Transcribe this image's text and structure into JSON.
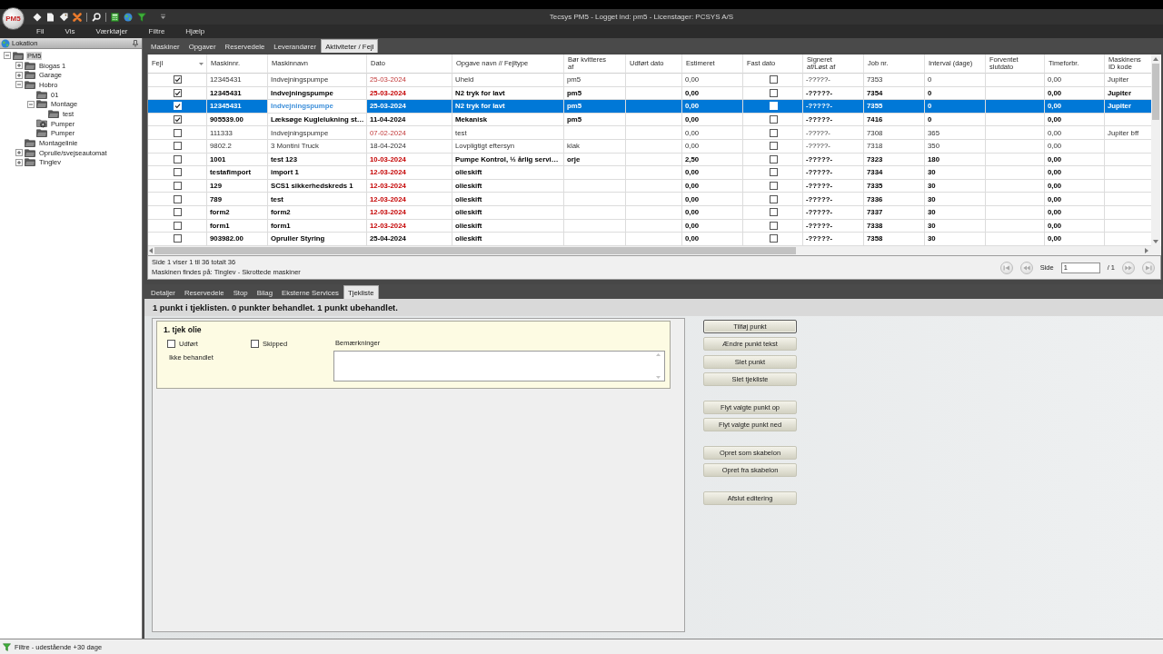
{
  "window": {
    "logo": "PM5",
    "title": "Tecsys PM5 - Logget ind: pm5 - Licenstager: PCSYS A/S"
  },
  "menu": [
    "Fil",
    "Vis",
    "Værktøjer",
    "Filtre",
    "Hjælp"
  ],
  "sidebar": {
    "title": "Lokation",
    "tree": [
      {
        "label": "PM5",
        "kind": "folder",
        "expanded": true,
        "selected": true,
        "children": [
          {
            "label": "Biogas 1",
            "kind": "folder",
            "expanded": false,
            "selected": false
          },
          {
            "label": "Garage",
            "kind": "folder",
            "expanded": false,
            "selected": false
          },
          {
            "label": "Hobro",
            "kind": "folder",
            "expanded": true,
            "selected": false,
            "children": [
              {
                "label": "01",
                "kind": "folder",
                "selected": false
              },
              {
                "label": "Montage",
                "kind": "folder",
                "expanded": true,
                "selected": false,
                "children": [
                  {
                    "label": "test",
                    "kind": "folder",
                    "selected": false
                  }
                ]
              },
              {
                "label": "Pumper",
                "kind": "machine-folder",
                "selected": false
              },
              {
                "label": "Pumper",
                "kind": "folder",
                "selected": false
              }
            ]
          },
          {
            "label": "Montagelinie",
            "kind": "folder",
            "selected": false
          },
          {
            "label": "Oprulle/svejseautomat",
            "kind": "folder",
            "expanded": false,
            "selected": false
          },
          {
            "label": "Tinglev",
            "kind": "folder",
            "expanded": false,
            "selected": false
          }
        ]
      }
    ]
  },
  "tabs": [
    {
      "label": "Maskiner",
      "selected": false
    },
    {
      "label": "Opgaver",
      "selected": false
    },
    {
      "label": "Reservedele",
      "selected": false
    },
    {
      "label": "Leverandører",
      "selected": false
    },
    {
      "label": "Aktiviteter / Fejl",
      "selected": true
    }
  ],
  "table": {
    "columns": [
      {
        "label": "Fejl",
        "kind": "check",
        "sorted": true
      },
      {
        "label": "Maskinnr.",
        "kind": "text",
        "sorted": false
      },
      {
        "label": "Maskinnavn",
        "kind": "text",
        "sorted": false
      },
      {
        "label": "Dato",
        "kind": "date",
        "sorted": false
      },
      {
        "label": "Opgave navn // Fejltype",
        "kind": "text",
        "sorted": false
      },
      {
        "label": "Bør kvitteres af",
        "kind": "text",
        "sorted": false
      },
      {
        "label": "Udført dato",
        "kind": "text",
        "sorted": false
      },
      {
        "label": "Estimeret",
        "kind": "text",
        "sorted": false
      },
      {
        "label": "Fast dato",
        "kind": "check",
        "sorted": false
      },
      {
        "label": "Signeret af/Løst af",
        "kind": "text",
        "sorted": false
      },
      {
        "label": "Job nr.",
        "kind": "text",
        "sorted": false
      },
      {
        "label": "Interval (dage)",
        "kind": "text",
        "sorted": false
      },
      {
        "label": "Forventet slutdato",
        "kind": "text",
        "sorted": false
      },
      {
        "label": "Timeforbr.",
        "kind": "text",
        "sorted": false
      },
      {
        "label": "Maskinens ID kode",
        "kind": "text",
        "sorted": false
      }
    ],
    "rows": [
      {
        "selected": false,
        "bold": false,
        "overdue": true,
        "cells": [
          {
            "checked": true
          },
          "12345431",
          "Indvejningspumpe",
          "25-03-2024",
          "Uheld",
          "pm5",
          null,
          "0,00",
          {
            "checked": false
          },
          "-?????-",
          "7353",
          "0",
          null,
          "0,00",
          "Jupiter"
        ]
      },
      {
        "selected": false,
        "bold": true,
        "overdue": true,
        "cells": [
          {
            "checked": true
          },
          "12345431",
          "Indvejningspumpe",
          "25-03-2024",
          "N2 tryk for lavt",
          "pm5",
          null,
          "0,00",
          {
            "checked": false
          },
          "-?????-",
          "7354",
          "0",
          null,
          "0,00",
          "Jupiter"
        ]
      },
      {
        "selected": true,
        "bold": true,
        "overdue": true,
        "cells": [
          {
            "checked": true
          },
          "12345431",
          {
            "text": "Indvejningspumpe",
            "focused": true
          },
          "25-03-2024",
          "N2 tryk for lavt",
          "pm5",
          null,
          "0,00",
          {
            "checked": false
          },
          "-?????-",
          "7355",
          "0",
          null,
          "0,00",
          "Jupiter"
        ]
      },
      {
        "selected": false,
        "bold": true,
        "overdue": false,
        "cells": [
          {
            "checked": true
          },
          "905539.00",
          "Læksøge Kuglelukning st…",
          "11-04-2024",
          "Mekanisk",
          "pm5",
          null,
          "0,00",
          {
            "checked": false
          },
          "-?????-",
          "7416",
          "0",
          null,
          "0,00",
          null
        ]
      },
      {
        "selected": false,
        "bold": false,
        "overdue": true,
        "cells": [
          {
            "checked": false
          },
          "111333",
          "Indvejningspumpe",
          "07-02-2024",
          "test",
          null,
          null,
          "0,00",
          {
            "checked": false
          },
          "-?????-",
          "7308",
          "365",
          null,
          "0,00",
          "Jupiter bff"
        ]
      },
      {
        "selected": false,
        "bold": false,
        "overdue": false,
        "cells": [
          {
            "checked": false
          },
          "9802.2",
          "3 Montini Truck",
          "18-04-2024",
          "Lovpligtigt eftersyn",
          "klak",
          null,
          "0,00",
          {
            "checked": false
          },
          "-?????-",
          "7318",
          "350",
          null,
          "0,00",
          null
        ]
      },
      {
        "selected": false,
        "bold": true,
        "overdue": true,
        "cells": [
          {
            "checked": false
          },
          "1001",
          "test 123",
          "10-03-2024",
          "Pumpe Kontrol, ½ årlig servi…",
          "orje",
          null,
          "2,50",
          {
            "checked": false
          },
          "-?????-",
          "7323",
          "180",
          null,
          "0,00",
          null
        ]
      },
      {
        "selected": false,
        "bold": true,
        "overdue": true,
        "cells": [
          {
            "checked": false
          },
          "testafimport",
          "import 1",
          "12-03-2024",
          "olieskift",
          null,
          null,
          "0,00",
          {
            "checked": false
          },
          "-?????-",
          "7334",
          "30",
          null,
          "0,00",
          null
        ]
      },
      {
        "selected": false,
        "bold": true,
        "overdue": true,
        "cells": [
          {
            "checked": false
          },
          "129",
          "SCS1 sikkerhedskreds 1",
          "12-03-2024",
          "olieskift",
          null,
          null,
          "0,00",
          {
            "checked": false
          },
          "-?????-",
          "7335",
          "30",
          null,
          "0,00",
          null
        ]
      },
      {
        "selected": false,
        "bold": true,
        "overdue": true,
        "cells": [
          {
            "checked": false
          },
          "789",
          "test",
          "12-03-2024",
          "olieskift",
          null,
          null,
          "0,00",
          {
            "checked": false
          },
          "-?????-",
          "7336",
          "30",
          null,
          "0,00",
          null
        ]
      },
      {
        "selected": false,
        "bold": true,
        "overdue": true,
        "cells": [
          {
            "checked": false
          },
          "form2",
          "form2",
          "12-03-2024",
          "olieskift",
          null,
          null,
          "0,00",
          {
            "checked": false
          },
          "-?????-",
          "7337",
          "30",
          null,
          "0,00",
          null
        ]
      },
      {
        "selected": false,
        "bold": true,
        "overdue": true,
        "cells": [
          {
            "checked": false
          },
          "form1",
          "form1",
          "12-03-2024",
          "olieskift",
          null,
          null,
          "0,00",
          {
            "checked": false
          },
          "-?????-",
          "7338",
          "30",
          null,
          "0,00",
          null
        ]
      },
      {
        "selected": false,
        "bold": true,
        "overdue": false,
        "cells": [
          {
            "checked": false
          },
          "903982.00",
          "Opruller Styring",
          "25-04-2024",
          "olieskift",
          null,
          null,
          "0,00",
          {
            "checked": false
          },
          "-?????-",
          "7358",
          "30",
          null,
          "0,00",
          null
        ]
      }
    ]
  },
  "list_info": {
    "summary": "Side 1 viser 1 til 36 totalt 36",
    "location": "Maskinen findes på: Tinglev - Skrottede maskiner"
  },
  "pager": {
    "label": "Side",
    "page": "1",
    "total": "/ 1",
    "navigation_disabled": true
  },
  "detail_tabs": [
    {
      "label": "Detaljer",
      "selected": false
    },
    {
      "label": "Reservedele",
      "selected": false
    },
    {
      "label": "Stop",
      "selected": false
    },
    {
      "label": "Bilag",
      "selected": false
    },
    {
      "label": "Eksterne Services",
      "selected": false
    },
    {
      "label": "Tjekliste",
      "selected": true
    }
  ],
  "checklist": {
    "summary": "1 punkt i tjeklisten. 0 punkter behandlet. 1 punkt ubehandlet.",
    "items": [
      {
        "title": "1. tjek olie",
        "options": [
          {
            "label": "Udført",
            "checked": false
          },
          {
            "label": "Skipped",
            "checked": false
          }
        ],
        "status": "Ikke behandlet",
        "remarks_label": "Bemærkninger"
      }
    ]
  },
  "actions": [
    [
      {
        "label": "Tilføj punkt",
        "default": true
      },
      {
        "label": "Ændre punkt tekst",
        "default": false
      },
      {
        "label": "Slet punkt",
        "default": false
      },
      {
        "label": "Slet tjekliste",
        "default": false
      }
    ],
    [
      {
        "label": "Flyt valgte punkt op",
        "default": false
      },
      {
        "label": "Flyt valgte punkt ned",
        "default": false
      }
    ],
    [
      {
        "label": "Opret som skabelon",
        "default": false
      },
      {
        "label": "Opret fra skabelon",
        "default": false
      }
    ],
    [
      {
        "label": "Afslut editering",
        "default": false
      }
    ]
  ],
  "status_bar": {
    "text": "Filtre - udestående +30 dage"
  }
}
